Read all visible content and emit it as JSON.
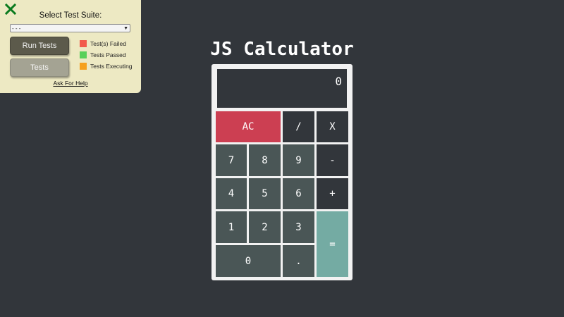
{
  "test_panel": {
    "title": "Select Test Suite:",
    "select_value": "- - -",
    "run_button": "Run Tests",
    "tests_button": "Tests",
    "legend": [
      {
        "label": "Test(s) Failed",
        "color": "#f25b4b"
      },
      {
        "label": "Tests Passed",
        "color": "#5ad05a"
      },
      {
        "label": "Tests Executing",
        "color": "#f6a11d"
      }
    ],
    "help_link": "Ask For Help",
    "close_icon": "close-x-icon",
    "close_color": "#0a7a1e"
  },
  "calculator": {
    "title": "JS Calculator",
    "display": "0",
    "keys": {
      "ac": "AC",
      "divide": "/",
      "multiply": "X",
      "seven": "7",
      "eight": "8",
      "nine": "9",
      "subtract": "-",
      "four": "4",
      "five": "5",
      "six": "6",
      "add": "+",
      "one": "1",
      "two": "2",
      "three": "3",
      "equals": "=",
      "zero": "0",
      "decimal": "."
    },
    "colors": {
      "background": "#32363b",
      "number_key": "#4a5656",
      "operator_key": "#32363b",
      "clear_key": "#cc3f52",
      "equals_key": "#74aba3"
    }
  }
}
